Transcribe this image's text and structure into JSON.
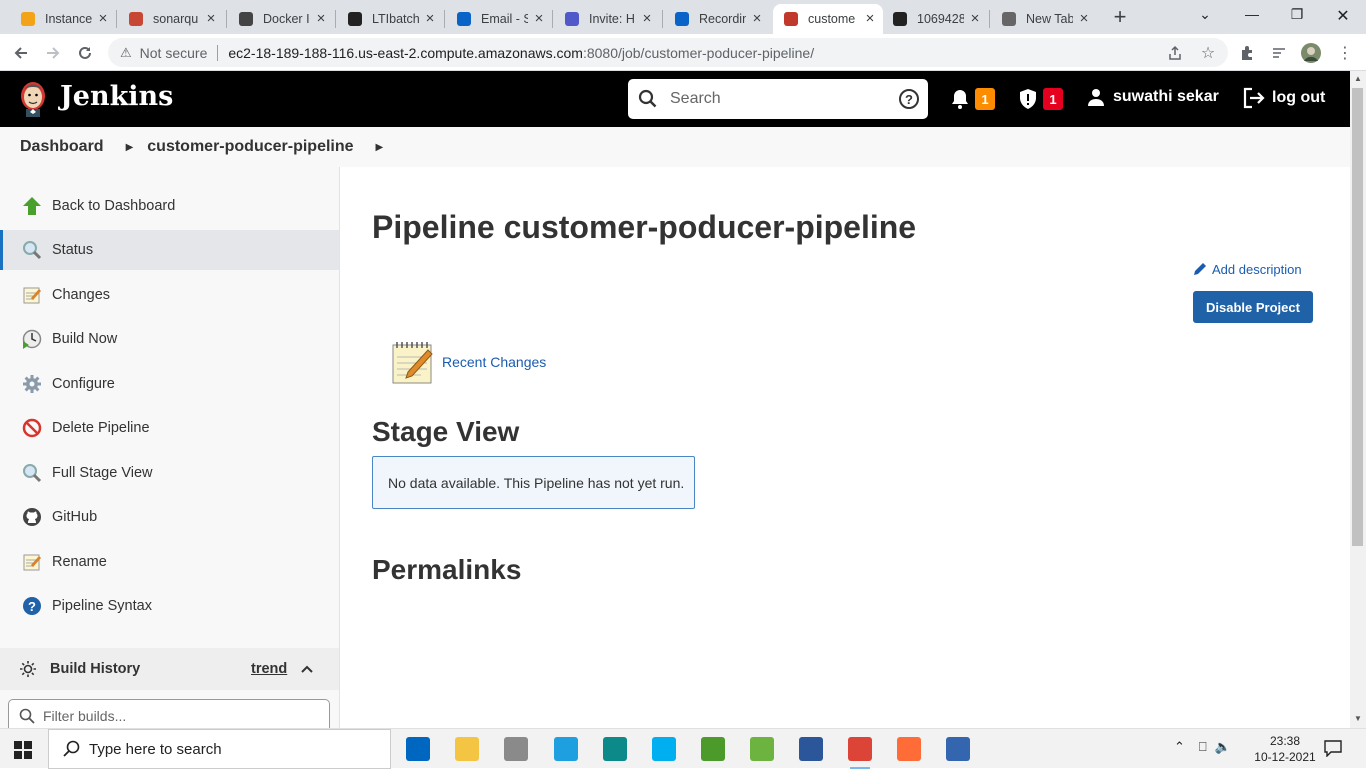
{
  "browser": {
    "tabs": [
      {
        "title": "Instance",
        "icon": "aws-instance-icon",
        "color": "#f2a318"
      },
      {
        "title": "sonarqu",
        "icon": "sonarqube-icon",
        "color": "#c74634"
      },
      {
        "title": "Docker I",
        "icon": "docker-hub-icon",
        "color": "#444"
      },
      {
        "title": "LTIbatch",
        "icon": "github-icon",
        "color": "#222"
      },
      {
        "title": "Email - S",
        "icon": "outlook-icon",
        "color": "#0a64c8"
      },
      {
        "title": "Invite: H",
        "icon": "teams-icon",
        "color": "#5059c9"
      },
      {
        "title": "Recordin",
        "icon": "onedrive-icon",
        "color": "#0a64c8"
      },
      {
        "title": "custome",
        "icon": "jenkins-tab-icon",
        "color": "#c0392b"
      },
      {
        "title": "1069428",
        "icon": "github-icon",
        "color": "#222"
      },
      {
        "title": "New Tab",
        "icon": "chrome-newtab-icon",
        "color": "#666"
      }
    ],
    "active_tab": 7,
    "security_label": "Not secure",
    "url_host": "ec2-18-189-188-116.us-east-2.compute.amazonaws.com",
    "url_path": ":8080/job/customer-poducer-pipeline/"
  },
  "header": {
    "brand": "Jenkins",
    "search_placeholder": "Search",
    "notifications_count": "1",
    "security_count": "1",
    "user": "suwathi sekar",
    "logout": "log out",
    "notif_color": "#fe8c00",
    "security_color": "#e6001f"
  },
  "breadcrumb": {
    "items": [
      "Dashboard",
      "customer-poducer-pipeline"
    ]
  },
  "sidebar": {
    "items": [
      {
        "label": "Back to Dashboard",
        "icon": "up-arrow-icon"
      },
      {
        "label": "Status",
        "icon": "magnifier-icon"
      },
      {
        "label": "Changes",
        "icon": "notepad-icon"
      },
      {
        "label": "Build Now",
        "icon": "clock-play-icon"
      },
      {
        "label": "Configure",
        "icon": "gear-icon"
      },
      {
        "label": "Delete Pipeline",
        "icon": "no-entry-icon"
      },
      {
        "label": "Full Stage View",
        "icon": "magnifier-icon"
      },
      {
        "label": "GitHub",
        "icon": "github-icon"
      },
      {
        "label": "Rename",
        "icon": "notepad-icon"
      },
      {
        "label": "Pipeline Syntax",
        "icon": "help-circle-icon"
      }
    ],
    "active_index": 1,
    "build_history": {
      "title": "Build History",
      "trend": "trend",
      "filter_placeholder": "Filter builds..."
    }
  },
  "main": {
    "title": "Pipeline customer-poducer-pipeline",
    "add_description": "Add description",
    "disable_button": "Disable Project",
    "recent_changes": "Recent Changes",
    "stage_view_title": "Stage View",
    "stage_view_message": "No data available. This Pipeline has not yet run.",
    "permalinks_title": "Permalinks",
    "accent_color": "#1f62a8"
  },
  "taskbar": {
    "search_placeholder": "Type here to search",
    "apps": [
      {
        "icon": "store-icon",
        "color": "#0067c0"
      },
      {
        "icon": "file-explorer-icon",
        "color": "#f4c542"
      },
      {
        "icon": "dropbox-icon",
        "color": "#8a8a8a"
      },
      {
        "icon": "internet-explorer-icon",
        "color": "#1ea0e0"
      },
      {
        "icon": "edge-icon",
        "color": "#0c8a8a"
      },
      {
        "icon": "skype-icon",
        "color": "#00aff0"
      },
      {
        "icon": "chart-app-icon",
        "color": "#4c9a2a"
      },
      {
        "icon": "spring-icon",
        "color": "#6db33f"
      },
      {
        "icon": "word-icon",
        "color": "#2b579a"
      },
      {
        "icon": "chrome-icon",
        "color": "#db4437"
      },
      {
        "icon": "postman-icon",
        "color": "#ff6c37"
      },
      {
        "icon": "network-app-icon",
        "color": "#3466b0"
      }
    ],
    "time": "23:38",
    "date": "10-12-2021"
  }
}
